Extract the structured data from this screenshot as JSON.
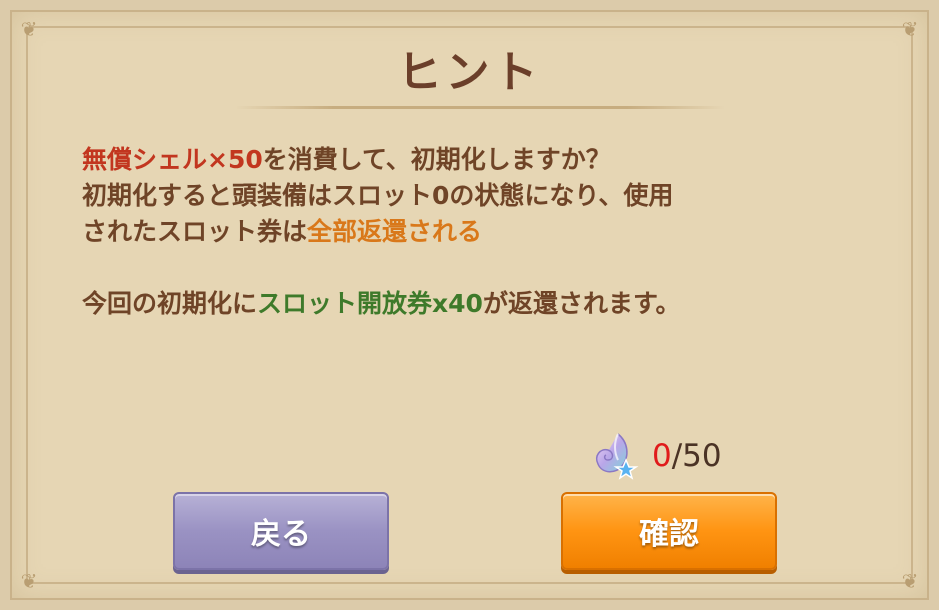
{
  "dialog": {
    "title": "ヒント",
    "body": {
      "line1_cost": "無償シェル×50",
      "line1_rest": "を消費して、初期化しますか？",
      "line2": "初期化すると頭装備はスロット0の状態になり、使用",
      "line3_start": "されたスロット券は",
      "line3_highlight": "全部返還される",
      "line4_start": "今回の初期化に",
      "line4_highlight": "スロット開放券x40",
      "line4_end": "が返還されます。"
    },
    "cost": {
      "icon": "shell-icon",
      "have": "0",
      "need": "/50"
    },
    "buttons": {
      "back_label": "戻る",
      "confirm_label": "確認"
    },
    "colors": {
      "background": "#e6d6b4",
      "title": "#6b3f2a",
      "highlight_red": "#c2361f",
      "highlight_orange": "#d9781a",
      "highlight_green": "#3e7a2a",
      "confirm_button": "#ff9412",
      "back_button": "#9a92c3"
    }
  }
}
